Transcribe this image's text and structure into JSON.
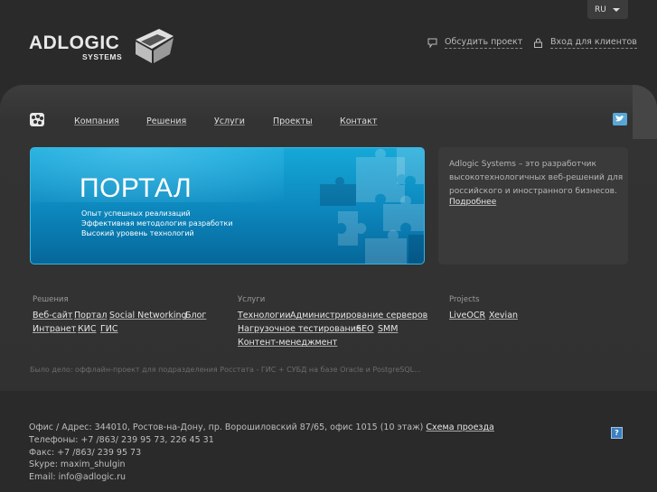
{
  "brand": {
    "name": "ADLOGIC",
    "sub": "SYSTEMS"
  },
  "lang": {
    "value": "RU"
  },
  "top_links": {
    "discuss": "Обсудить проект",
    "login": "Вход для клиентов"
  },
  "nav": {
    "items": [
      "Компания",
      "Решения",
      "Услуги",
      "Проекты",
      "Контакт"
    ]
  },
  "banner": {
    "title": "ПОРТАЛ",
    "lines": [
      "Опыт успешных реализаций",
      "Эффективная методология разработки",
      "Высокий уровень технологий"
    ]
  },
  "aside": {
    "text": "Adlogic Systems – это разработчик высокотехнологичных веб-решений для российского и иностранного бизнесов.",
    "more": "Подробнее"
  },
  "sections": {
    "solutions": {
      "title": "Решения",
      "row1": [
        "Веб-сайт",
        "Портал",
        "Social Networking",
        "Блог"
      ],
      "row2": [
        "Интранет",
        "КИС",
        "ГИС"
      ]
    },
    "services": {
      "title": "Услуги",
      "row1": [
        "Технологии",
        "Администрирование серверов"
      ],
      "row2": [
        "Нагрузочное тестирование",
        "SEO",
        "SMM"
      ],
      "row3": [
        "Контент-менеджмент"
      ]
    },
    "projects": {
      "title": "Projects",
      "row1": [
        "LiveOCR",
        "Xevian"
      ]
    }
  },
  "was_done": "Было дело: оффлайн-проект для подразделения Росстата - ГИС + СУБД на базе Oracle и PostgreSQL...",
  "footer": {
    "address": "Офис / Адрес: 344010, Ростов-на-Дону, пр. Ворошиловский 87/65, офис 1015 (10 этаж)",
    "map_link": "Схема проезда",
    "phones": "Телефоны: +7 /863/ 239 95 73, 226 45 31",
    "fax": "Факс: +7 /863/ 239 95 73",
    "skype": "Skype: maxim_shulgin",
    "email": "Email: info@adlogic.ru",
    "help": "?"
  }
}
